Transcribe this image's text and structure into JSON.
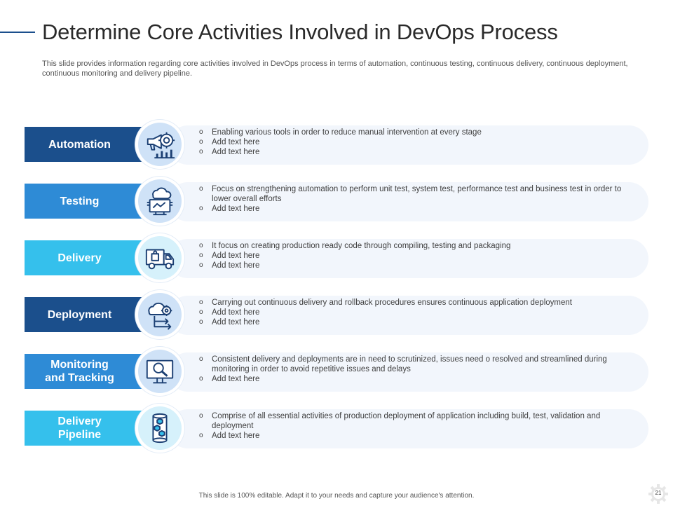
{
  "title": "Determine Core Activities Involved in DevOps Process",
  "subtitle": "This slide provides information regarding core activities involved in DevOps process in terms of automation, continuous testing, continuous delivery, continuous deployment, continuous monitoring and delivery pipeline.",
  "rows": [
    {
      "label": "Automation",
      "icon": "megaphone-gear-chart-icon",
      "bullets": [
        "Enabling various tools in order to reduce manual intervention at every  stage",
        "Add text here",
        "Add text here"
      ]
    },
    {
      "label": "Testing",
      "icon": "cloud-monitor-icon",
      "bullets": [
        "Focus on strengthening automation to perform unit test, system test, performance test and business test in order to  lower overall efforts",
        "Add text here"
      ]
    },
    {
      "label": "Delivery",
      "icon": "delivery-truck-icon",
      "bullets": [
        "It focus on creating production ready code through compiling, testing and packaging",
        "Add text here",
        "Add text here"
      ]
    },
    {
      "label": "Deployment",
      "icon": "cloud-gear-arrows-icon",
      "bullets": [
        "Carrying out continuous delivery and rollback procedures ensures continuous application deployment",
        "Add text here",
        "Add text here"
      ]
    },
    {
      "label_line1": "Monitoring",
      "label_line2": "and Tracking",
      "icon": "monitor-magnifier-icon",
      "bullets": [
        "Consistent delivery and deployments are in need to scrutinized, issues need o resolved and streamlined during monitoring in order to avoid repetitive issues and delays",
        "Add text here"
      ]
    },
    {
      "label_line1": "Delivery",
      "label_line2": "Pipeline",
      "icon": "pipeline-cubes-icon",
      "bullets": [
        "Comprise of all essential activities of production deployment of application including build, test, validation and deployment",
        "Add text here"
      ]
    }
  ],
  "colors": {
    "dark_blue": "#1b4f8c",
    "mid_blue": "#2e8bd6",
    "light_blue": "#35c0ec",
    "card_bg": "#f2f6fc",
    "icon_stroke": "#1b3f73"
  },
  "footer": "This slide is 100% editable.  Adapt it to your needs and capture your audience's attention.",
  "page_number": "21"
}
